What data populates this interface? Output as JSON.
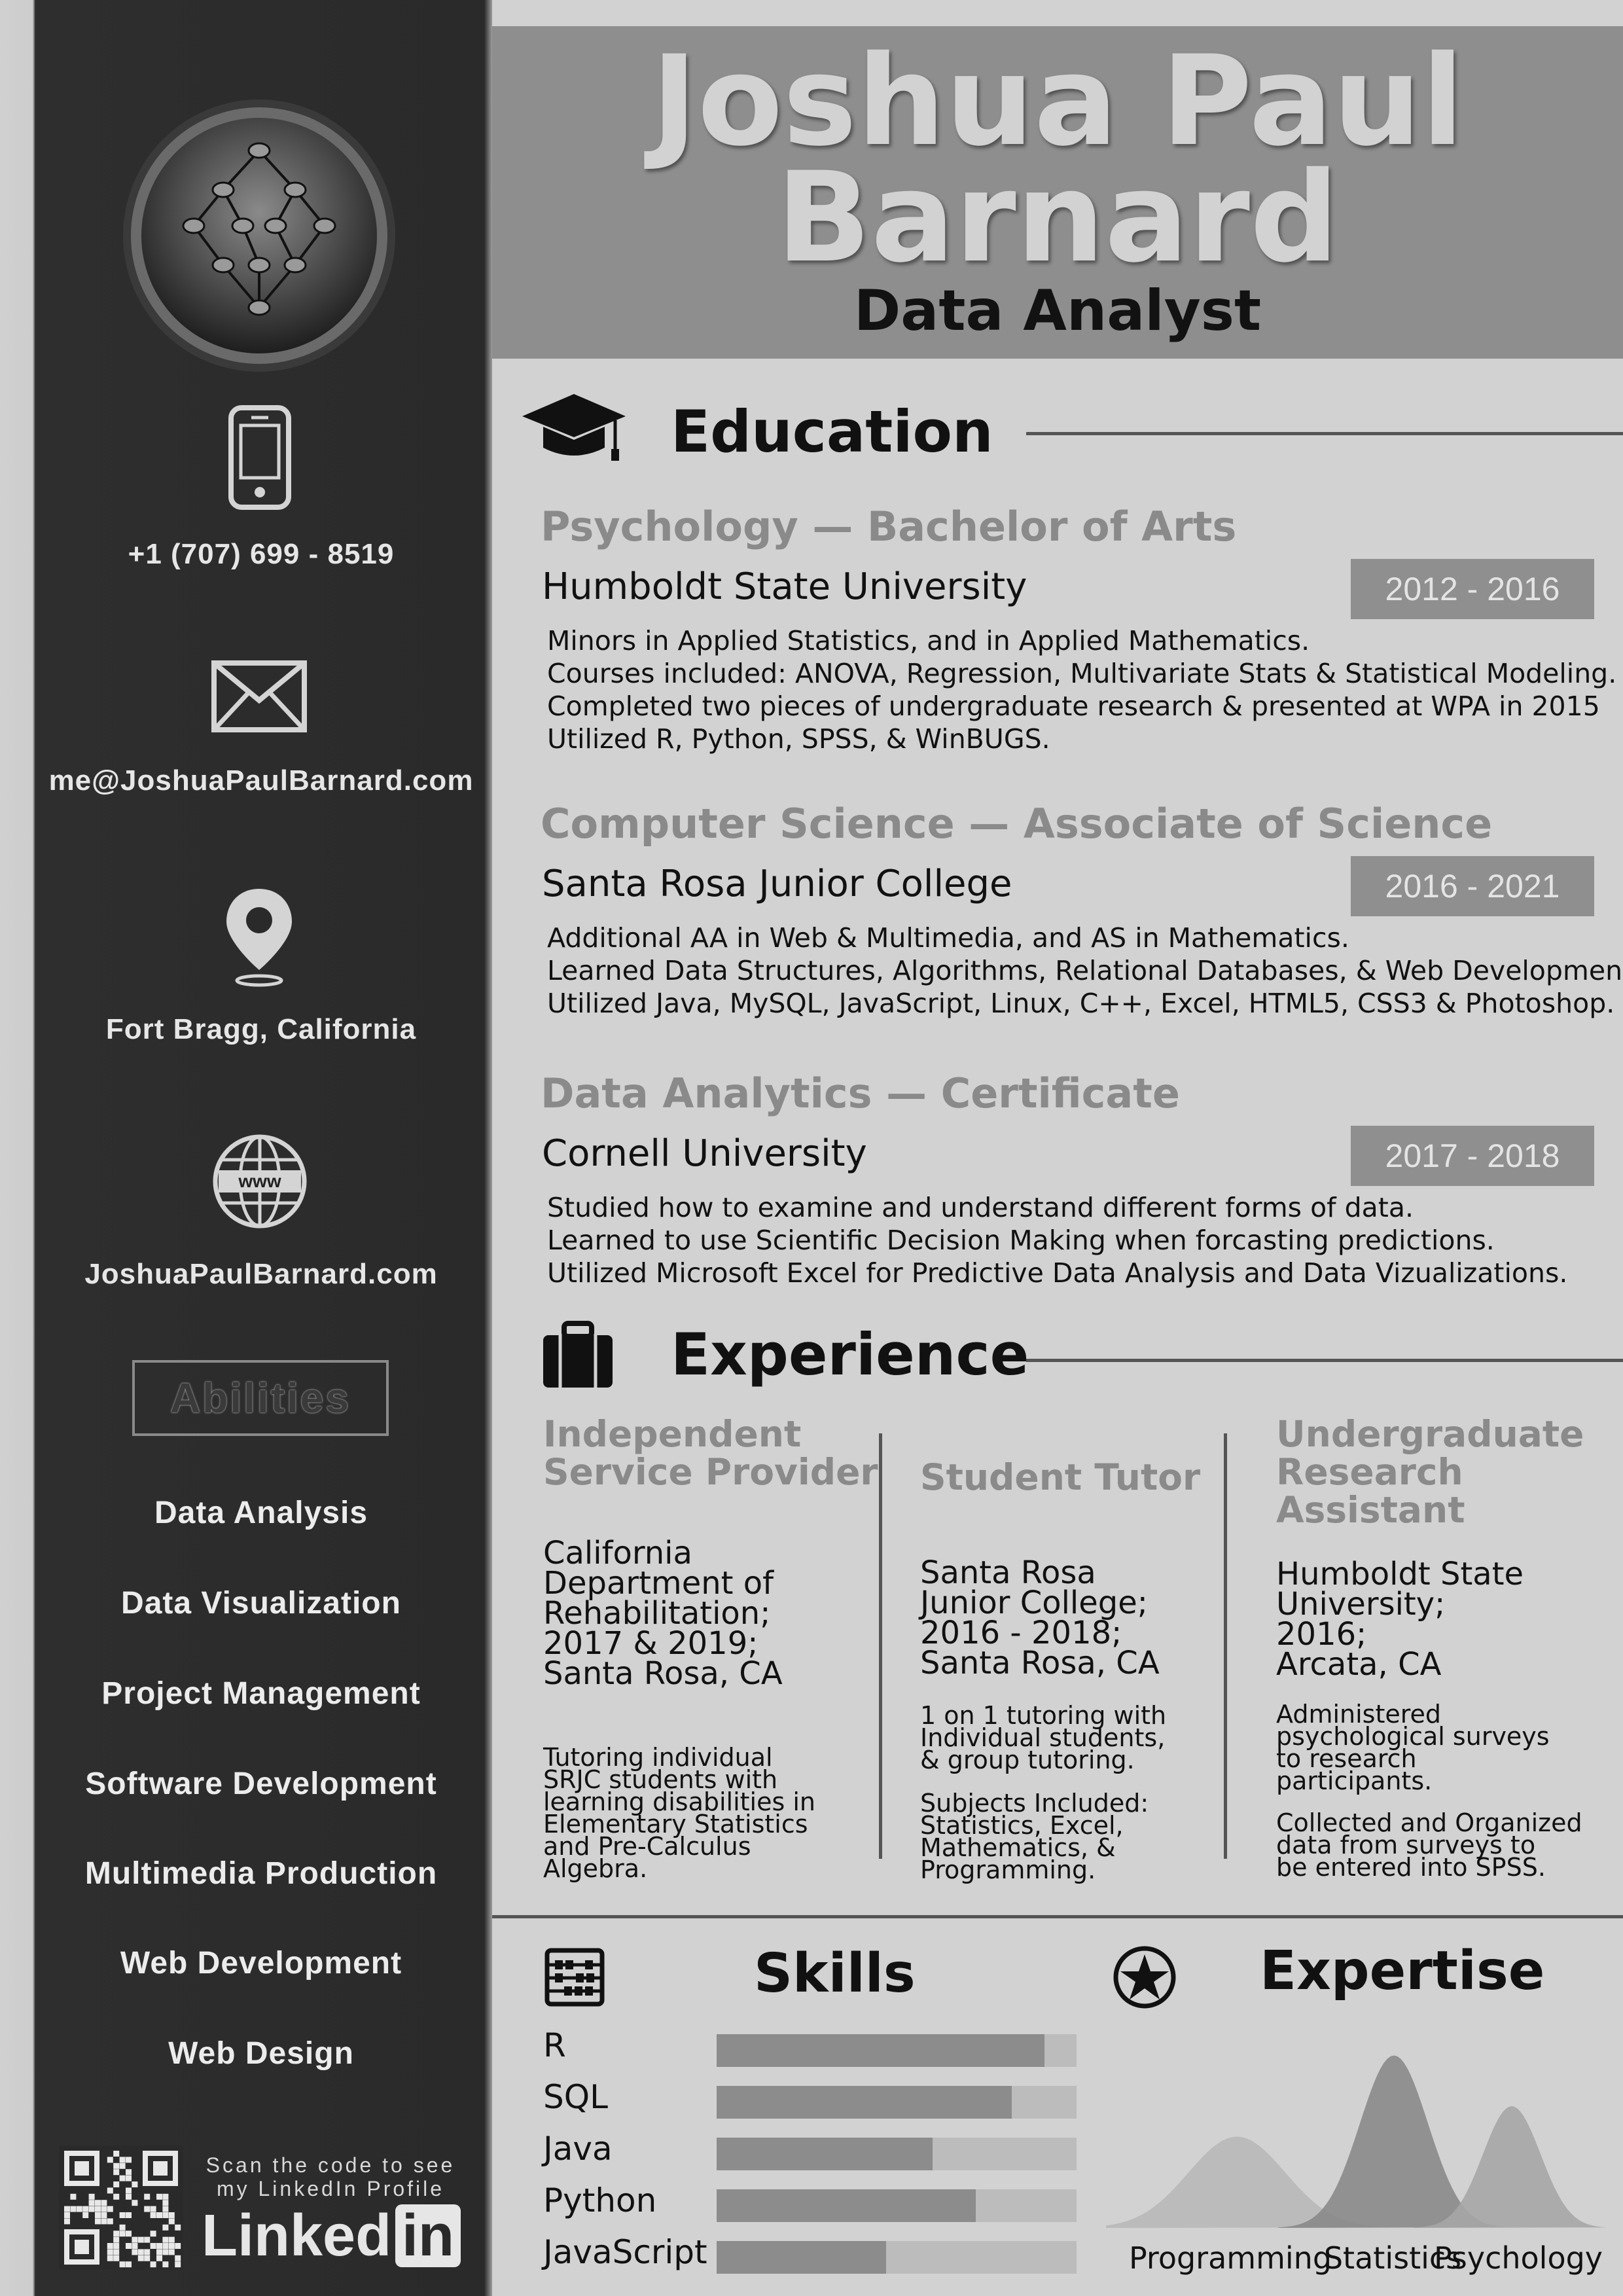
{
  "header": {
    "first_line": "Joshua Paul",
    "second_line": "Barnard",
    "job_title": "Data Analyst"
  },
  "contact": {
    "phone": "+1 (707) 699 - 8519",
    "email": "me@JoshuaPaulBarnard.com",
    "location": "Fort Bragg, California",
    "website": "JoshuaPaulBarnard.com",
    "www_icon_text": "www"
  },
  "abilities": {
    "heading": "Abilities",
    "items": [
      "Data Analysis",
      "Data Visualization",
      "Project Management",
      "Software Development",
      "Multimedia Production",
      "Web Development",
      "Web Design"
    ]
  },
  "linkedin": {
    "scan_line1": "Scan the code to see",
    "scan_line2": "my LinkedIn Profile",
    "logo_text": "Linked",
    "logo_in": "in"
  },
  "education": {
    "heading": "Education",
    "entries": [
      {
        "degree": "Psychology — Bachelor of Arts",
        "school": "Humboldt State University",
        "years": "2012 - 2016",
        "details": [
          "Minors in Applied Statistics, and in Applied Mathematics.",
          "Courses included: ANOVA, Regression, Multivariate Stats & Statistical Modeling.",
          "Completed two pieces of undergraduate research & presented at WPA in 2015",
          "Utilized R, Python, SPSS, & WinBUGS."
        ]
      },
      {
        "degree": "Computer Science — Associate of Science",
        "school": "Santa Rosa Junior College",
        "years": "2016 - 2021",
        "details": [
          "Additional AA in Web & Multimedia, and AS in Mathematics.",
          "Learned Data Structures, Algorithms, Relational Databases, & Web Development.",
          "Utilized Java, MySQL, JavaScript, Linux, C++, Excel, HTML5, CSS3 & Photoshop."
        ]
      },
      {
        "degree": "Data Analytics — Certificate",
        "school": "Cornell University",
        "years": "2017 - 2018",
        "details": [
          "Studied how to examine and understand different forms of data.",
          "Learned to use Scientific Decision Making when forcasting predictions.",
          "Utilized Microsoft Excel for Predictive Data Analysis and Data Vizualizations."
        ]
      }
    ]
  },
  "experience": {
    "heading": "Experience",
    "columns": [
      {
        "title": [
          "Independent",
          "Service Provider"
        ],
        "org": [
          "California",
          "Department of",
          "Rehabilitation;",
          "2017 & 2019;",
          "Santa Rosa, CA"
        ],
        "desc": [
          "Tutoring individual",
          "SRJC students with",
          "learning disabilities in",
          "Elementary Statistics",
          "and Pre-Calculus",
          "Algebra."
        ]
      },
      {
        "title": [
          "Student Tutor"
        ],
        "org": [
          "Santa Rosa",
          "Junior College;",
          "2016 - 2018;",
          "Santa Rosa, CA"
        ],
        "desc": [
          "1 on 1 tutoring with",
          "Individual students,",
          "& group tutoring."
        ],
        "desc2": [
          "Subjects Included:",
          "Statistics, Excel,",
          "Mathematics, &",
          "Programming."
        ]
      },
      {
        "title": [
          "Undergraduate",
          "Research",
          "Assistant"
        ],
        "org": [
          "Humboldt State",
          "University;",
          "2016;",
          "Arcata, CA"
        ],
        "desc": [
          "Administered",
          "psychological surveys",
          "to research",
          "participants."
        ],
        "desc2": [
          "Collected and Organized",
          "data from surveys to",
          "be entered into SPSS."
        ]
      }
    ]
  },
  "skills": {
    "heading": "Skills",
    "items": [
      {
        "name": "R",
        "level": 0.91
      },
      {
        "name": "SQL",
        "level": 0.82
      },
      {
        "name": "Java",
        "level": 0.6
      },
      {
        "name": "Python",
        "level": 0.72
      },
      {
        "name": "JavaScript",
        "level": 0.47
      }
    ]
  },
  "expertise": {
    "heading": "Expertise",
    "areas": [
      {
        "name": "Programming",
        "level": 0.45
      },
      {
        "name": "Statistics",
        "level": 0.85
      },
      {
        "name": "Psychology",
        "level": 0.6
      }
    ]
  },
  "colors": {
    "sidebar": "#2a2a2a",
    "header_band": "#8e8e8e",
    "accent_gray": "#8a8a8a",
    "page": "#d2d2d2"
  }
}
